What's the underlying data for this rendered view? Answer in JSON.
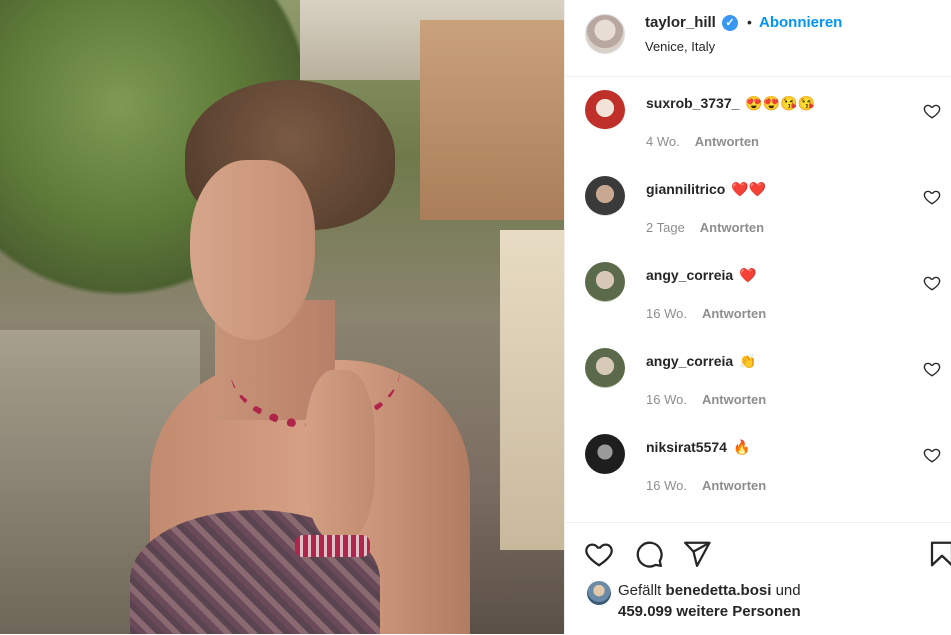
{
  "post": {
    "username": "taylor_hill",
    "verified_mark": "✓",
    "separator": "•",
    "follow_label": "Abonnieren",
    "location": "Venice, Italy"
  },
  "comments": [
    {
      "user": "suxrob_3737_",
      "text": "😍😍😘😘",
      "age": "4 Wo.",
      "reply": "Antworten"
    },
    {
      "user": "giannilitrico",
      "text": "❤️❤️",
      "age": "2 Tage",
      "reply": "Antworten"
    },
    {
      "user": "angy_correia",
      "text": "❤️",
      "age": "16 Wo.",
      "reply": "Antworten"
    },
    {
      "user": "angy_correia",
      "text": "👏",
      "age": "16 Wo.",
      "reply": "Antworten"
    },
    {
      "user": "niksirat5574",
      "text": "🔥",
      "age": "16 Wo.",
      "reply": "Antworten"
    }
  ],
  "likes": {
    "prefix": "Gefällt",
    "user": "benedetta.bosi",
    "conjunction": "und",
    "count": "459.099",
    "suffix": "weitere Personen"
  },
  "icons": {
    "heart": "heart-icon",
    "comment": "comment-icon",
    "share": "share-icon",
    "save": "bookmark-icon"
  },
  "colors": {
    "accent": "#0095f6",
    "verified": "#3897f0",
    "text": "#262626",
    "muted": "#8e8e8e",
    "divider": "#efefef"
  }
}
